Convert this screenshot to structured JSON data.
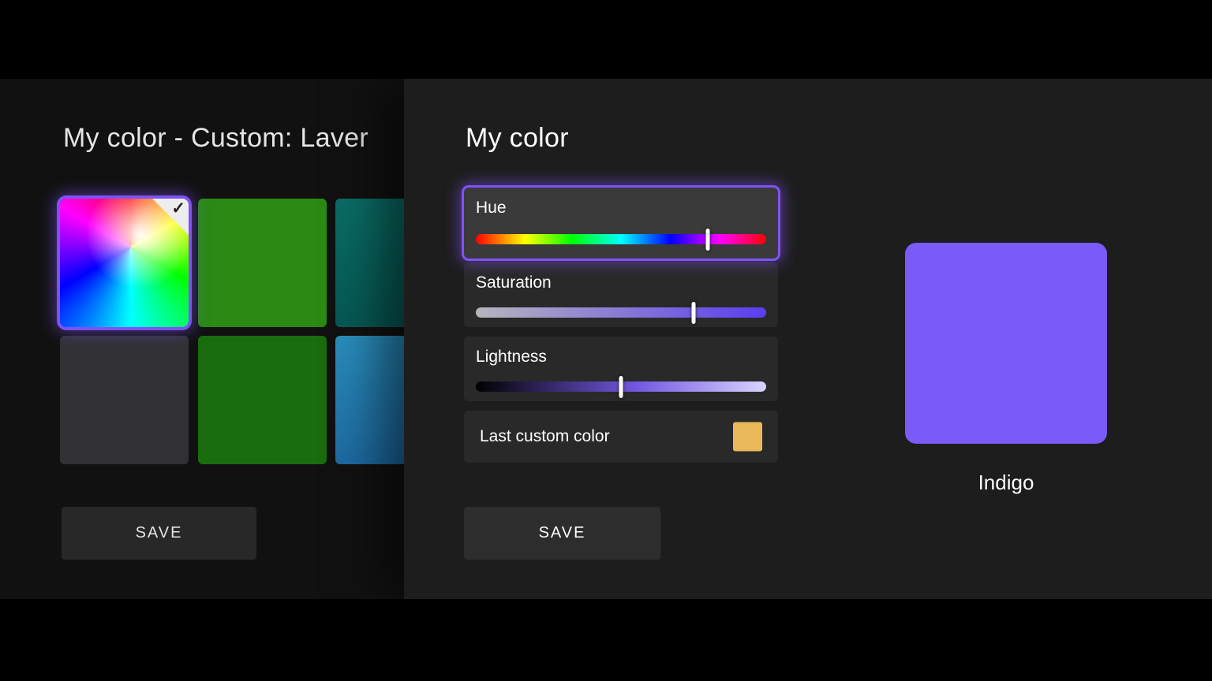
{
  "left_panel": {
    "title": "My color - Custom: Laver",
    "save_label": "SAVE",
    "swatches": {
      "custom_rainbow": {
        "selected": true
      },
      "green": {
        "color": "#2f9a17"
      },
      "teal": {
        "color": "#0a6e66"
      },
      "gray": {
        "color": "#37373b"
      },
      "dark_green": {
        "color": "#1e7a10"
      },
      "blue": {
        "color": "#2a8ec4"
      }
    },
    "check_icon": "✓"
  },
  "right_panel": {
    "title": "My color",
    "hue": {
      "label": "Hue",
      "thumb_left": "80%"
    },
    "saturation": {
      "label": "Saturation",
      "thumb_left": "75%"
    },
    "lightness": {
      "label": "Lightness",
      "thumb_left": "50%"
    },
    "last_custom": {
      "label": "Last custom color",
      "color": "#e9b959"
    },
    "save_label": "SAVE",
    "preview": {
      "label": "Indigo",
      "color": "#7a5bf7"
    },
    "focus_color": "#8152f6"
  }
}
